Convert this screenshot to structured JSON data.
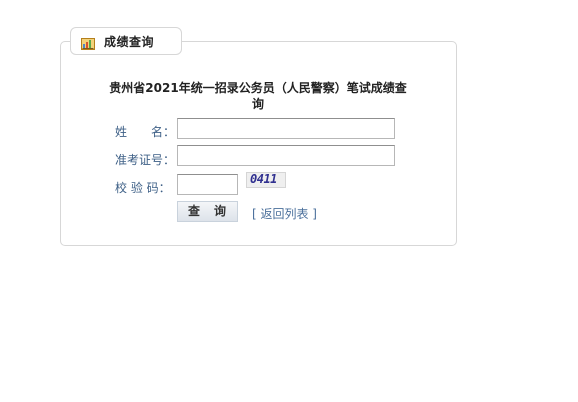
{
  "tab": {
    "title": "成绩查询",
    "icon": "report-chart-icon"
  },
  "form": {
    "title": "贵州省2021年统一招录公务员（人民警察）笔试成绩查询",
    "name_label": "姓　　名：",
    "name_value": "",
    "exam_id_label": "准考证号：",
    "exam_id_value": "",
    "captcha_label": "校 验 码：",
    "captcha_value": "",
    "captcha_text": "0411"
  },
  "actions": {
    "query_label": "查　询",
    "back_label": "[ 返回列表 ]"
  },
  "colors": {
    "label": "#3d5f86",
    "border": "#d7d7d7",
    "link": "#4a6f9b"
  }
}
